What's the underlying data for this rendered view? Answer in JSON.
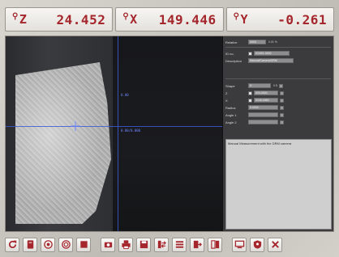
{
  "dro": {
    "z": {
      "axis": "Z",
      "value": "24.452"
    },
    "x": {
      "axis": "X",
      "value": "149.446"
    },
    "y": {
      "axis": "Y",
      "value": "-0.261"
    }
  },
  "panel": {
    "tolerance_label": "Relative",
    "tolerance_value": "0000",
    "tolerance_unit": "0.01 %",
    "id_label": "ID no.",
    "id_value": "01/001 0002",
    "description_label": "Description",
    "description_value": "Manual/Camera/DRM",
    "shape_label": "Shape",
    "shape_value": "X",
    "shape_unit": "0.5",
    "z_label": "Z",
    "z_value": "024.4520",
    "x_label": "X",
    "x_value": "0149.4460",
    "radius_label": "Radius",
    "radius_value": "0.0000",
    "angle1_label": "Angle 1",
    "angle2_label": "Angle 2",
    "message": "Manual Measurement with the DRM camera"
  },
  "camera": {
    "label_a": "0.00",
    "label_b": "0.00/0.000"
  },
  "toolbar": {
    "buttons": [
      "refresh-icon",
      "document-icon",
      "target-icon",
      "target-alt-icon",
      "stop-icon",
      "camera-icon",
      "print-icon",
      "save-icon",
      "transfer-icon",
      "list-icon",
      "export-icon",
      "split-icon",
      "screen-icon",
      "record-icon",
      "close-icon"
    ]
  },
  "colors": {
    "dro_text": "#a5262c",
    "icon_red": "#a5262c",
    "crosshair": "#3d5bd6"
  }
}
